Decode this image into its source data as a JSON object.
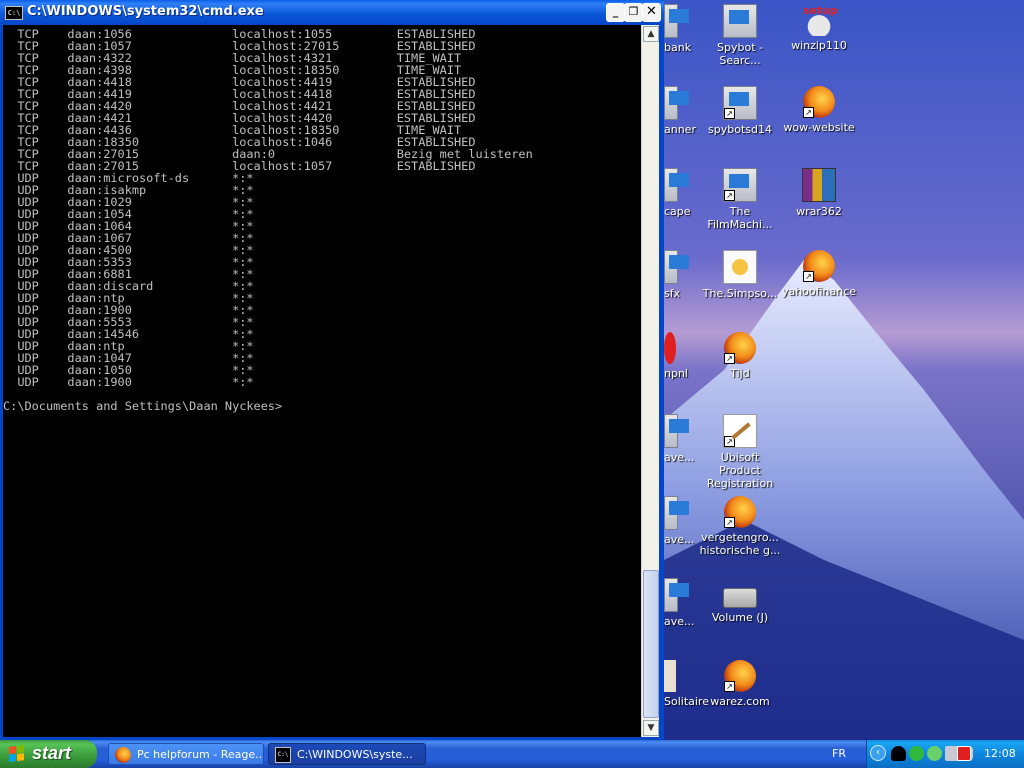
{
  "window": {
    "title": "C:\\WINDOWS\\system32\\cmd.exe",
    "sys_icon_text": "C:\\",
    "buttons": {
      "minimize": "_",
      "maximize": "❐",
      "close": "✕"
    }
  },
  "console": {
    "rows": [
      [
        "TCP",
        "daan:1056",
        "localhost:1055",
        "ESTABLISHED"
      ],
      [
        "TCP",
        "daan:1057",
        "localhost:27015",
        "ESTABLISHED"
      ],
      [
        "TCP",
        "daan:4322",
        "localhost:4321",
        "TIME_WAIT"
      ],
      [
        "TCP",
        "daan:4398",
        "localhost:18350",
        "TIME_WAIT"
      ],
      [
        "TCP",
        "daan:4418",
        "localhost:4419",
        "ESTABLISHED"
      ],
      [
        "TCP",
        "daan:4419",
        "localhost:4418",
        "ESTABLISHED"
      ],
      [
        "TCP",
        "daan:4420",
        "localhost:4421",
        "ESTABLISHED"
      ],
      [
        "TCP",
        "daan:4421",
        "localhost:4420",
        "ESTABLISHED"
      ],
      [
        "TCP",
        "daan:4436",
        "localhost:18350",
        "TIME_WAIT"
      ],
      [
        "TCP",
        "daan:18350",
        "localhost:1046",
        "ESTABLISHED"
      ],
      [
        "TCP",
        "daan:27015",
        "daan:0",
        "Bezig met luisteren"
      ],
      [
        "TCP",
        "daan:27015",
        "localhost:1057",
        "ESTABLISHED"
      ],
      [
        "UDP",
        "daan:microsoft-ds",
        "*:*",
        ""
      ],
      [
        "UDP",
        "daan:isakmp",
        "*:*",
        ""
      ],
      [
        "UDP",
        "daan:1029",
        "*:*",
        ""
      ],
      [
        "UDP",
        "daan:1054",
        "*:*",
        ""
      ],
      [
        "UDP",
        "daan:1064",
        "*:*",
        ""
      ],
      [
        "UDP",
        "daan:1067",
        "*:*",
        ""
      ],
      [
        "UDP",
        "daan:4500",
        "*:*",
        ""
      ],
      [
        "UDP",
        "daan:5353",
        "*:*",
        ""
      ],
      [
        "UDP",
        "daan:6881",
        "*:*",
        ""
      ],
      [
        "UDP",
        "daan:discard",
        "*:*",
        ""
      ],
      [
        "UDP",
        "daan:ntp",
        "*:*",
        ""
      ],
      [
        "UDP",
        "daan:1900",
        "*:*",
        ""
      ],
      [
        "UDP",
        "daan:5553",
        "*:*",
        ""
      ],
      [
        "UDP",
        "daan:14546",
        "*:*",
        ""
      ],
      [
        "UDP",
        "daan:ntp",
        "*:*",
        ""
      ],
      [
        "UDP",
        "daan:1047",
        "*:*",
        ""
      ],
      [
        "UDP",
        "daan:1050",
        "*:*",
        ""
      ],
      [
        "UDP",
        "daan:1900",
        "*:*",
        ""
      ]
    ],
    "prompt": "C:\\Documents and Settings\\Daan Nyckees>"
  },
  "desktop": {
    "partial_icons": [
      {
        "label": "bank",
        "icon": "program-icon"
      },
      {
        "label": "anner",
        "icon": "program-icon"
      },
      {
        "label": "cape",
        "icon": "program-icon"
      },
      {
        "label": "sfx",
        "icon": "program-icon"
      },
      {
        "label": "npnl",
        "icon": "program-icon"
      },
      {
        "label": "ave...",
        "icon": "program-icon"
      },
      {
        "label": "ave...",
        "icon": "program-icon"
      },
      {
        "label": "ave...",
        "icon": "program-icon"
      },
      {
        "label": "Solitaire",
        "icon": "program-icon"
      }
    ],
    "icons_col1": [
      {
        "label": "Spybot - Searc...",
        "icon": "spybot-icon"
      },
      {
        "label": "spybotsd14",
        "icon": "setup-icon"
      },
      {
        "label": "The FilmMachi...",
        "icon": "setup-icon"
      },
      {
        "label": "The.Simpso...",
        "icon": "document-icon"
      },
      {
        "label": "Tijd",
        "icon": "firefox-icon"
      },
      {
        "label": "Ubisoft Product Registration",
        "icon": "pen-icon"
      },
      {
        "label": "vergetengro... historische g...",
        "icon": "firefox-icon"
      },
      {
        "label": "Volume (J)",
        "icon": "drive-icon"
      },
      {
        "label": "warez.com",
        "icon": "firefox-icon"
      }
    ],
    "icons_col2": [
      {
        "label": "winzip110",
        "icon": "setup-icon",
        "badge": "setup"
      },
      {
        "label": "wow-website",
        "icon": "firefox-icon"
      },
      {
        "label": "wrar362",
        "icon": "winrar-icon"
      },
      {
        "label": "yahoofinance",
        "icon": "firefox-icon"
      }
    ]
  },
  "taskbar": {
    "start_label": "start",
    "tasks": [
      {
        "label": "Pc helpforum - Reage...",
        "icon": "firefox-icon",
        "active": false
      },
      {
        "label": "C:\\WINDOWS\\syste...",
        "icon": "cmd-icon",
        "active": true
      }
    ],
    "language": "FR",
    "clock": "12:08",
    "tray_icons": [
      "chevron-left-icon",
      "black-cat-icon",
      "green-c-icon",
      "green-e-icon",
      "user-icon",
      "microphone-icon",
      "antivirus-icon"
    ],
    "cmd_icon_text": "C:\\"
  },
  "colors": {
    "console_bg": "#000000",
    "console_text": "#c0c0c0",
    "titlebar": "#0054e3",
    "start_green": "#3a9a3a"
  }
}
